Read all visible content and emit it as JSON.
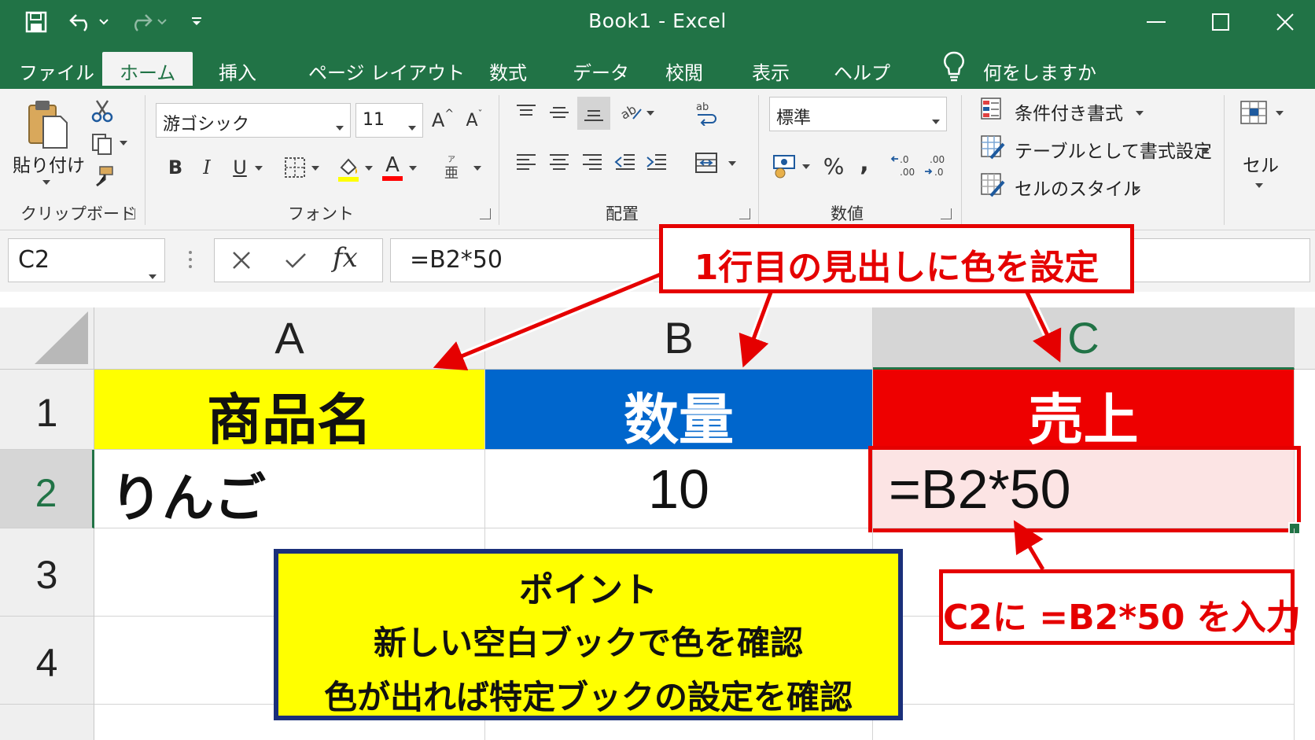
{
  "window": {
    "title": "Book1  -  Excel"
  },
  "tabs": [
    "ファイル",
    "ホーム",
    "挿入",
    "ページ レイアウト",
    "数式",
    "データ",
    "校閲",
    "表示",
    "ヘルプ"
  ],
  "tell_me": "何をしますか",
  "ribbon": {
    "clipboard": {
      "paste_label": "貼り付け",
      "group_label": "クリップボード"
    },
    "font": {
      "name": "游ゴシック",
      "size": "11",
      "group_label": "フォント",
      "bold": "B",
      "italic": "I",
      "underline": "U",
      "increase": "A",
      "decrease": "A",
      "color_letter": "A"
    },
    "alignment": {
      "group_label": "配置"
    },
    "number": {
      "format": "標準",
      "group_label": "数値",
      "percent": "%",
      "comma": ","
    },
    "styles": {
      "conditional": "条件付き書式",
      "as_table": "テーブルとして書式設定",
      "cell_styles": "セルのスタイル"
    },
    "cells": {
      "label": "セル"
    }
  },
  "formula_bar": {
    "name_box": "C2",
    "fx": "fx",
    "formula": "=B2*50"
  },
  "sheet": {
    "columns": [
      "A",
      "B",
      "C"
    ],
    "rows": [
      "1",
      "2",
      "3",
      "4"
    ],
    "cells": {
      "A1": "商品名",
      "B1": "数量",
      "C1": "売上",
      "A2": "りんご",
      "B2": "10",
      "C2": "=B2*50"
    }
  },
  "annotations": {
    "header_callout": "1行目の見出しに色を設定",
    "c2_callout": "C2に =B2*50 を入力",
    "point_title": "ポイント",
    "point_line1": "新しい空白ブックで色を確認",
    "point_line2": "色が出れば特定ブックの設定を確認"
  },
  "colors": {
    "excel_green": "#217346",
    "header_a": "#ffff00",
    "header_b": "#0066cc",
    "header_c": "#ee0000",
    "c2_fill": "#fce4e4",
    "callout_red": "#e50000",
    "point_border": "#1a2f7a"
  }
}
